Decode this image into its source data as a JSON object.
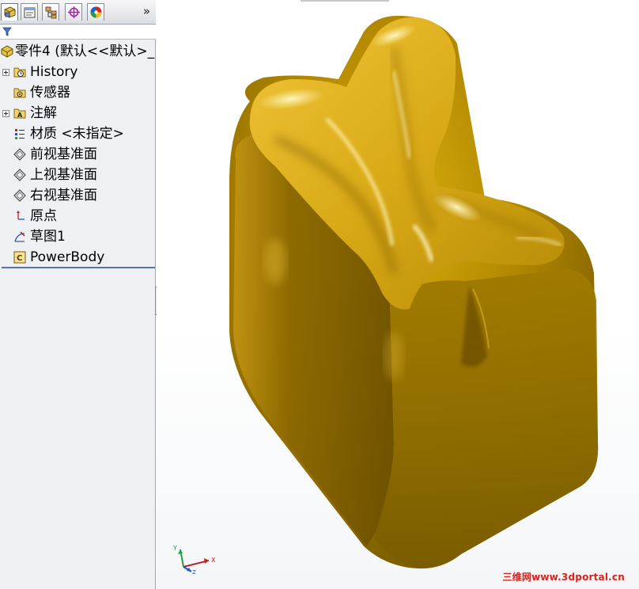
{
  "tabs": [
    {
      "name": "feature-manager"
    },
    {
      "name": "property-manager"
    },
    {
      "name": "configuration-manager"
    },
    {
      "name": "dimxpert-manager"
    },
    {
      "name": "display-manager"
    }
  ],
  "tab_overflow": "»",
  "tree": {
    "root": "零件4 (默认<<默认>_",
    "items": [
      {
        "label": "History",
        "icon": "history-folder-icon",
        "expandable": true
      },
      {
        "label": "传感器",
        "icon": "sensor-folder-icon",
        "expandable": false
      },
      {
        "label": "注解",
        "icon": "annotation-folder-icon",
        "expandable": true
      },
      {
        "label": "材质 <未指定>",
        "icon": "material-icon",
        "expandable": false
      },
      {
        "label": "前视基准面",
        "icon": "plane-icon",
        "expandable": false
      },
      {
        "label": "上视基准面",
        "icon": "plane-icon",
        "expandable": false
      },
      {
        "label": "右视基准面",
        "icon": "plane-icon",
        "expandable": false
      },
      {
        "label": "原点",
        "icon": "origin-icon",
        "expandable": false
      },
      {
        "label": "草图1",
        "icon": "sketch-icon",
        "expandable": false
      },
      {
        "label": "PowerBody",
        "icon": "body-feature-icon",
        "expandable": false
      }
    ]
  },
  "triad": {
    "x": "X",
    "y": "Y",
    "z": "Z"
  },
  "watermark": "三维网www.3dportal.cn",
  "colors": {
    "model_gold": "#c9a106",
    "model_shadow": "#6b5100",
    "tree_separator": "#5573b4",
    "panel_bg": "#eef0f4"
  }
}
